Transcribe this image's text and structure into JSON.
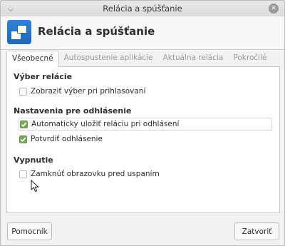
{
  "window": {
    "title": "Relácia a spúšťanie"
  },
  "header": {
    "title": "Relácia a spúšťanie"
  },
  "tabs": [
    {
      "label": "Všeobecné",
      "active": true
    },
    {
      "label": "Autospustenie aplikácie",
      "active": false
    },
    {
      "label": "Aktuálna relácia",
      "active": false
    },
    {
      "label": "Pokročilé",
      "active": false
    }
  ],
  "sections": {
    "session_choice": {
      "title": "Výber relácie",
      "options": [
        {
          "label": "Zobraziť výber pri prihlasovaní",
          "checked": false
        }
      ]
    },
    "logout": {
      "title": "Nastavenia pre odhlásenie",
      "options": [
        {
          "label": "Automaticky uložiť reláciu pri odhlásení",
          "checked": true
        },
        {
          "label": "Potvrdiť odhlásenie",
          "checked": true
        }
      ]
    },
    "shutdown": {
      "title": "Vypnutie",
      "options": [
        {
          "label": "Zamknúť obrazovku pred uspaním",
          "checked": false
        }
      ]
    }
  },
  "buttons": {
    "help": "Pomocník",
    "close": "Zatvoriť"
  },
  "colors": {
    "accent": "#1e66b8",
    "checkbox_checked": "#7aa55a"
  }
}
